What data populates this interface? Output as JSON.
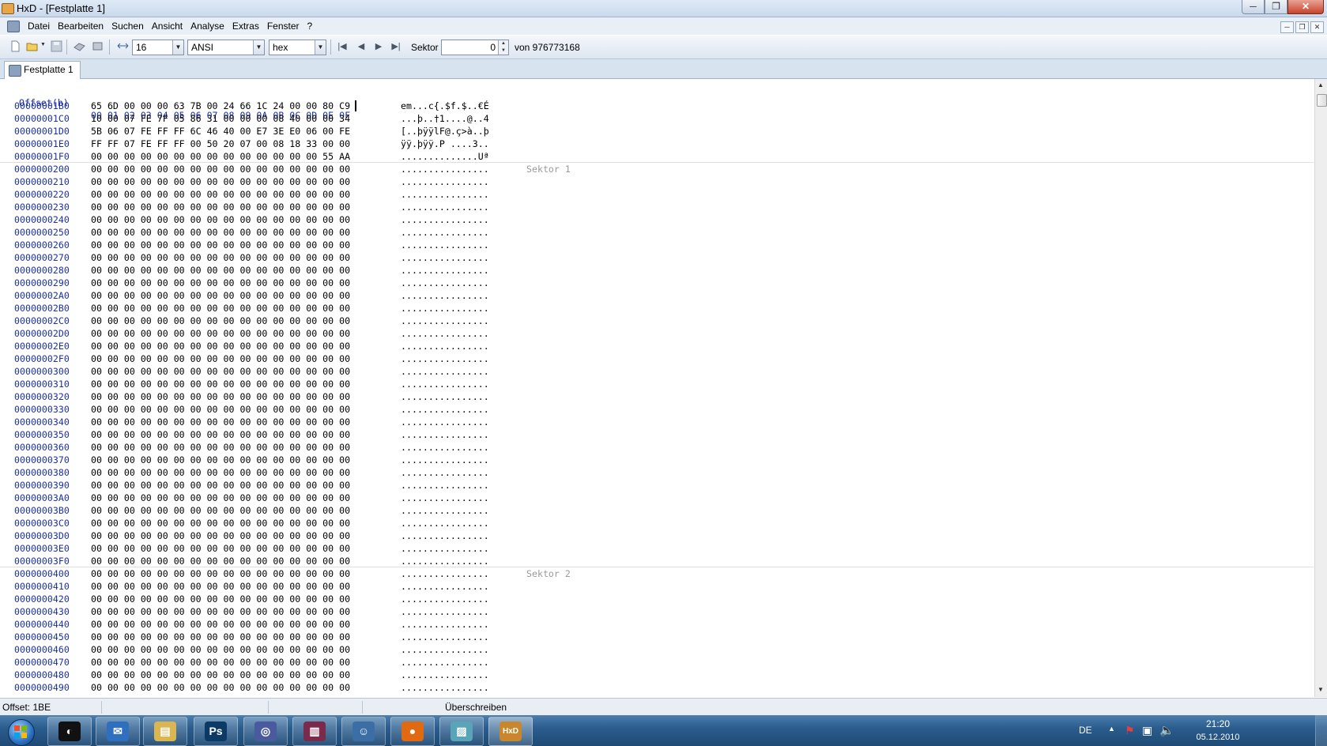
{
  "window": {
    "title": "HxD - [Festplatte 1]"
  },
  "menu": {
    "items": [
      "Datei",
      "Bearbeiten",
      "Suchen",
      "Ansicht",
      "Analyse",
      "Extras",
      "Fenster",
      "?"
    ]
  },
  "toolbar": {
    "bytes_per_row": "16",
    "charset": "ANSI",
    "offset_base": "hex",
    "sector_label": "Sektor",
    "sector_value": "0",
    "sector_total": "von 976773168"
  },
  "tabs": [
    {
      "label": "Festplatte 1"
    }
  ],
  "hex": {
    "header": {
      "offset": "Offset(h)",
      "columns": "00 01 02 03 04 05 06 07 08 09 0A 0B 0C 0D 0E 0F"
    },
    "sector_labels": [
      "Sektor 1",
      "Sektor 2"
    ],
    "rows": [
      {
        "offset": "00000001B0",
        "bytes": "65 6D 00 00 00 63 7B 00 24 66 1C 24 00 00 80 C9",
        "ascii": "em...c{.$f.$..€É"
      },
      {
        "offset": "00000001C0",
        "bytes": "10 00 07 FE 7F 05 86 31 00 00 00 08 40 00 00 34",
        "ascii": "...þ..†1....@..4"
      },
      {
        "offset": "00000001D0",
        "bytes": "5B 06 07 FE FF FF 6C 46 40 00 E7 3E E0 06 00 FE",
        "ascii": "[..þÿÿlF@.ç>à..þ"
      },
      {
        "offset": "00000001E0",
        "bytes": "FF FF 07 FE FF FF 00 50 20 07 00 08 18 33 00 00",
        "ascii": "ÿÿ.þÿÿ.P ....3.."
      },
      {
        "offset": "00000001F0",
        "bytes": "00 00 00 00 00 00 00 00 00 00 00 00 00 00 55 AA",
        "ascii": "..............Uª"
      },
      {
        "offset": "0000000200",
        "bytes": "00 00 00 00 00 00 00 00 00 00 00 00 00 00 00 00",
        "ascii": "................"
      },
      {
        "offset": "0000000210",
        "bytes": "00 00 00 00 00 00 00 00 00 00 00 00 00 00 00 00",
        "ascii": "................"
      },
      {
        "offset": "0000000220",
        "bytes": "00 00 00 00 00 00 00 00 00 00 00 00 00 00 00 00",
        "ascii": "................"
      },
      {
        "offset": "0000000230",
        "bytes": "00 00 00 00 00 00 00 00 00 00 00 00 00 00 00 00",
        "ascii": "................"
      },
      {
        "offset": "0000000240",
        "bytes": "00 00 00 00 00 00 00 00 00 00 00 00 00 00 00 00",
        "ascii": "................"
      },
      {
        "offset": "0000000250",
        "bytes": "00 00 00 00 00 00 00 00 00 00 00 00 00 00 00 00",
        "ascii": "................"
      },
      {
        "offset": "0000000260",
        "bytes": "00 00 00 00 00 00 00 00 00 00 00 00 00 00 00 00",
        "ascii": "................"
      },
      {
        "offset": "0000000270",
        "bytes": "00 00 00 00 00 00 00 00 00 00 00 00 00 00 00 00",
        "ascii": "................"
      },
      {
        "offset": "0000000280",
        "bytes": "00 00 00 00 00 00 00 00 00 00 00 00 00 00 00 00",
        "ascii": "................"
      },
      {
        "offset": "0000000290",
        "bytes": "00 00 00 00 00 00 00 00 00 00 00 00 00 00 00 00",
        "ascii": "................"
      },
      {
        "offset": "00000002A0",
        "bytes": "00 00 00 00 00 00 00 00 00 00 00 00 00 00 00 00",
        "ascii": "................"
      },
      {
        "offset": "00000002B0",
        "bytes": "00 00 00 00 00 00 00 00 00 00 00 00 00 00 00 00",
        "ascii": "................"
      },
      {
        "offset": "00000002C0",
        "bytes": "00 00 00 00 00 00 00 00 00 00 00 00 00 00 00 00",
        "ascii": "................"
      },
      {
        "offset": "00000002D0",
        "bytes": "00 00 00 00 00 00 00 00 00 00 00 00 00 00 00 00",
        "ascii": "................"
      },
      {
        "offset": "00000002E0",
        "bytes": "00 00 00 00 00 00 00 00 00 00 00 00 00 00 00 00",
        "ascii": "................"
      },
      {
        "offset": "00000002F0",
        "bytes": "00 00 00 00 00 00 00 00 00 00 00 00 00 00 00 00",
        "ascii": "................"
      },
      {
        "offset": "0000000300",
        "bytes": "00 00 00 00 00 00 00 00 00 00 00 00 00 00 00 00",
        "ascii": "................"
      },
      {
        "offset": "0000000310",
        "bytes": "00 00 00 00 00 00 00 00 00 00 00 00 00 00 00 00",
        "ascii": "................"
      },
      {
        "offset": "0000000320",
        "bytes": "00 00 00 00 00 00 00 00 00 00 00 00 00 00 00 00",
        "ascii": "................"
      },
      {
        "offset": "0000000330",
        "bytes": "00 00 00 00 00 00 00 00 00 00 00 00 00 00 00 00",
        "ascii": "................"
      },
      {
        "offset": "0000000340",
        "bytes": "00 00 00 00 00 00 00 00 00 00 00 00 00 00 00 00",
        "ascii": "................"
      },
      {
        "offset": "0000000350",
        "bytes": "00 00 00 00 00 00 00 00 00 00 00 00 00 00 00 00",
        "ascii": "................"
      },
      {
        "offset": "0000000360",
        "bytes": "00 00 00 00 00 00 00 00 00 00 00 00 00 00 00 00",
        "ascii": "................"
      },
      {
        "offset": "0000000370",
        "bytes": "00 00 00 00 00 00 00 00 00 00 00 00 00 00 00 00",
        "ascii": "................"
      },
      {
        "offset": "0000000380",
        "bytes": "00 00 00 00 00 00 00 00 00 00 00 00 00 00 00 00",
        "ascii": "................"
      },
      {
        "offset": "0000000390",
        "bytes": "00 00 00 00 00 00 00 00 00 00 00 00 00 00 00 00",
        "ascii": "................"
      },
      {
        "offset": "00000003A0",
        "bytes": "00 00 00 00 00 00 00 00 00 00 00 00 00 00 00 00",
        "ascii": "................"
      },
      {
        "offset": "00000003B0",
        "bytes": "00 00 00 00 00 00 00 00 00 00 00 00 00 00 00 00",
        "ascii": "................"
      },
      {
        "offset": "00000003C0",
        "bytes": "00 00 00 00 00 00 00 00 00 00 00 00 00 00 00 00",
        "ascii": "................"
      },
      {
        "offset": "00000003D0",
        "bytes": "00 00 00 00 00 00 00 00 00 00 00 00 00 00 00 00",
        "ascii": "................"
      },
      {
        "offset": "00000003E0",
        "bytes": "00 00 00 00 00 00 00 00 00 00 00 00 00 00 00 00",
        "ascii": "................"
      },
      {
        "offset": "00000003F0",
        "bytes": "00 00 00 00 00 00 00 00 00 00 00 00 00 00 00 00",
        "ascii": "................"
      },
      {
        "offset": "0000000400",
        "bytes": "00 00 00 00 00 00 00 00 00 00 00 00 00 00 00 00",
        "ascii": "................"
      },
      {
        "offset": "0000000410",
        "bytes": "00 00 00 00 00 00 00 00 00 00 00 00 00 00 00 00",
        "ascii": "................"
      },
      {
        "offset": "0000000420",
        "bytes": "00 00 00 00 00 00 00 00 00 00 00 00 00 00 00 00",
        "ascii": "................"
      },
      {
        "offset": "0000000430",
        "bytes": "00 00 00 00 00 00 00 00 00 00 00 00 00 00 00 00",
        "ascii": "................"
      },
      {
        "offset": "0000000440",
        "bytes": "00 00 00 00 00 00 00 00 00 00 00 00 00 00 00 00",
        "ascii": "................"
      },
      {
        "offset": "0000000450",
        "bytes": "00 00 00 00 00 00 00 00 00 00 00 00 00 00 00 00",
        "ascii": "................"
      },
      {
        "offset": "0000000460",
        "bytes": "00 00 00 00 00 00 00 00 00 00 00 00 00 00 00 00",
        "ascii": "................"
      },
      {
        "offset": "0000000470",
        "bytes": "00 00 00 00 00 00 00 00 00 00 00 00 00 00 00 00",
        "ascii": "................"
      },
      {
        "offset": "0000000480",
        "bytes": "00 00 00 00 00 00 00 00 00 00 00 00 00 00 00 00",
        "ascii": "................"
      },
      {
        "offset": "0000000490",
        "bytes": "00 00 00 00 00 00 00 00 00 00 00 00 00 00 00 00",
        "ascii": "................"
      }
    ]
  },
  "status": {
    "offset": "Offset: 1BE",
    "mode": "Überschreiben"
  },
  "taskbar": {
    "apps": [
      {
        "name": "steam-icon",
        "glyph": "◐",
        "color": "#111111"
      },
      {
        "name": "thunderbird-icon",
        "glyph": "✉",
        "color": "#2f6fbf"
      },
      {
        "name": "explorer-icon",
        "glyph": "▤",
        "color": "#d9b650"
      },
      {
        "name": "photoshop-icon",
        "glyph": "Ps",
        "color": "#0b3a66"
      },
      {
        "name": "vs-icon",
        "glyph": "◎",
        "color": "#4a5a9e"
      },
      {
        "name": "winrar-icon",
        "glyph": "▥",
        "color": "#7a2a4a"
      },
      {
        "name": "pidgin-icon",
        "glyph": "☺",
        "color": "#3a6ea5"
      },
      {
        "name": "firefox-icon",
        "glyph": "●",
        "color": "#e06a12"
      },
      {
        "name": "notepad-icon",
        "glyph": "▨",
        "color": "#5aa4b8"
      },
      {
        "name": "hxd-icon",
        "glyph": "HxD",
        "color": "#c9862c"
      }
    ],
    "language": "DE",
    "time": "21:20",
    "date": "05.12.2010"
  }
}
